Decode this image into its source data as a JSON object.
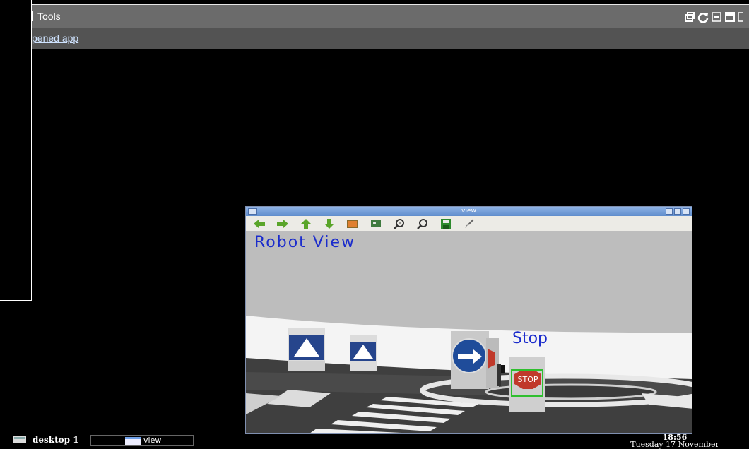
{
  "topbar": {
    "title": "Tools"
  },
  "subbar": {
    "link_text": "pened app"
  },
  "window": {
    "title": "view",
    "toolbar_icons": [
      "arrow-left-icon",
      "arrow-right-icon",
      "arrow-up-icon",
      "arrow-down-icon",
      "image-icon",
      "picture-icon",
      "zoom-in-icon",
      "zoom-out-icon",
      "save-icon",
      "brush-icon"
    ]
  },
  "scene": {
    "heading": "Robot View",
    "detection_label": "Stop",
    "sign_text": "STOP"
  },
  "taskbar": {
    "desktop_label": "desktop 1",
    "task_label": "view",
    "time": "18:56",
    "date": "Tuesday 17 November"
  },
  "colors": {
    "annotation_blue": "#1b2ccc",
    "detection_green": "#2fbf2f",
    "titlebar_blue": "#5f8ccc"
  }
}
